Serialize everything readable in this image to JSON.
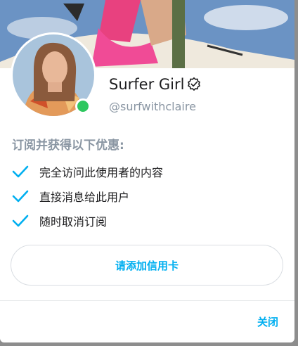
{
  "profile": {
    "display_name": "Surfer Girl",
    "username": "@surfwithclaire",
    "verified_icon": "verified-badge-icon",
    "online_status_color": "#2ec75f"
  },
  "benefits": {
    "title": "订阅并获得以下优惠:",
    "items": [
      "完全访问此使用者的内容",
      "直接消息给此用户",
      "随时取消订阅"
    ],
    "check_icon": "check-icon",
    "check_color": "#00aff0"
  },
  "actions": {
    "add_card_label": "请添加信用卡",
    "close_label": "关闭"
  },
  "colors": {
    "accent": "#00aff0",
    "muted_text": "#8a96a3"
  }
}
